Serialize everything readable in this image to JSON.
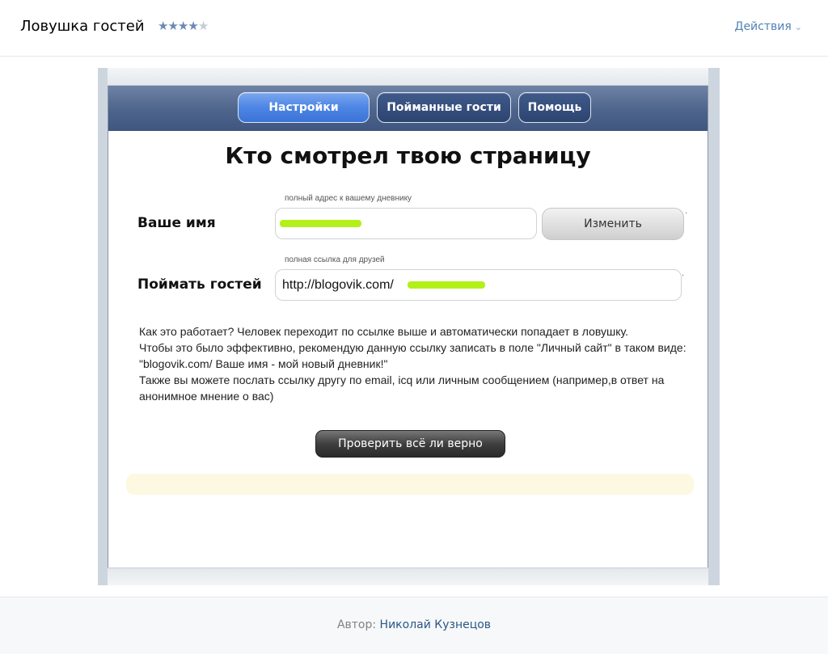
{
  "header": {
    "title": "Ловушка гостей",
    "rating": 4,
    "rating_max": 5,
    "actions_label": "Действия"
  },
  "nav": {
    "settings": "Настройки",
    "guests": "Пойманные гости",
    "help": "Помощь",
    "active": "settings"
  },
  "main": {
    "title": "Кто смотрел твою страницу",
    "name_field": {
      "hint": "полный адрес к вашему дневнику",
      "label": "Ваше имя",
      "value": "",
      "button": "Изменить"
    },
    "catch_field": {
      "hint": "полная ссылка для друзей",
      "label": "Поймать гостей",
      "value": "http://blogovik.com/"
    },
    "description": [
      "Как это работает? Человек переходит по ссылке выше и автоматически попадает в ловушку.",
      "Чтобы это было эффективно, рекомендую данную ссылку записать в поле \"Личный сайт\" в таком виде: \"blogovik.com/ Ваше имя - мой новый дневник!\"",
      "Также вы можете послать ссылку другу по email, icq или личным сообщением (например,в ответ на анонимное мнение о вас)"
    ],
    "check_button": "Проверить всё ли верно",
    "highlight_color": "#b3f01a"
  },
  "footer": {
    "author_label": "Автор:",
    "author_name": "Николай Кузнецов"
  },
  "colors": {
    "link": "#5181b8",
    "nav_active": "#4e86e4",
    "nav_bar": "#4d648b"
  }
}
